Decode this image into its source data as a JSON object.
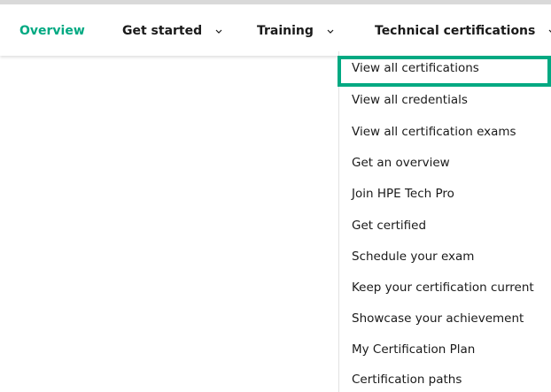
{
  "nav": {
    "items": [
      {
        "label": "Overview",
        "active": true,
        "has_chevron": false
      },
      {
        "label": "Get started",
        "active": false,
        "has_chevron": true
      },
      {
        "label": "Training",
        "active": false,
        "has_chevron": true
      },
      {
        "label": "Technical certifications",
        "active": false,
        "has_chevron": true
      }
    ],
    "chevron_icon": "chevron-down-icon"
  },
  "dropdown": {
    "items": [
      {
        "label": "View all certifications",
        "highlighted": true
      },
      {
        "label": "View all credentials"
      },
      {
        "label": "View all certification exams"
      },
      {
        "label": "Get an overview"
      },
      {
        "label": "Join HPE Tech Pro"
      },
      {
        "label": "Get certified"
      },
      {
        "label": "Schedule your exam"
      },
      {
        "label": "Keep your certification current"
      },
      {
        "label": "Showcase your achievement"
      },
      {
        "label": "My Certification Plan"
      },
      {
        "label": "Certification paths"
      }
    ]
  },
  "colors": {
    "accent": "#01a982",
    "text": "#1a1a1a",
    "divider": "#e2e2e2"
  }
}
